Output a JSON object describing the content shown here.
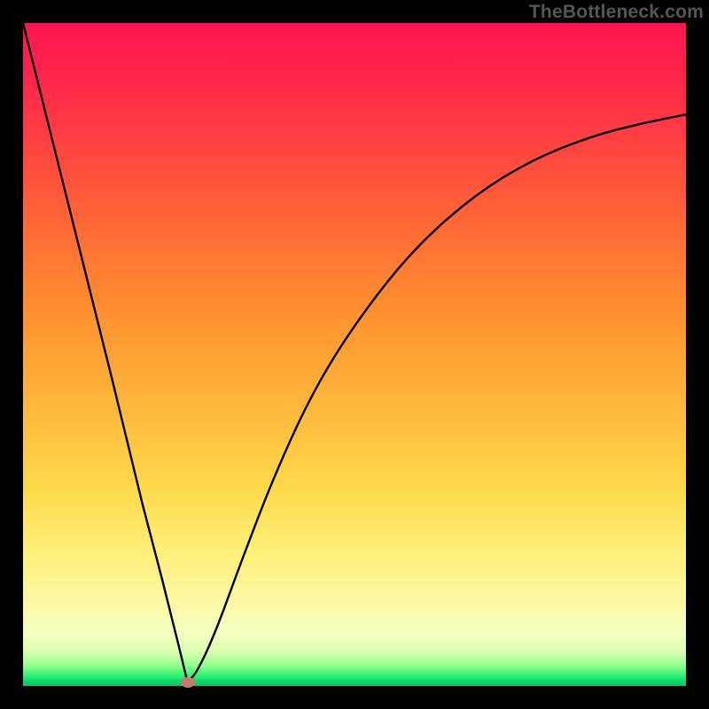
{
  "watermark": "TheBottleneck.com",
  "colors": {
    "curve_stroke": "#000000",
    "marker_fill": "#c97a6a",
    "frame_bg": "#ffffff",
    "outer_bg": "#000000"
  },
  "marker": {
    "x_frac": 0.248,
    "y_frac": 0.994
  },
  "chart_data": {
    "type": "line",
    "title": "",
    "xlabel": "",
    "ylabel": "",
    "xlim": [
      0,
      1
    ],
    "ylim": [
      0,
      1
    ],
    "note": "Axes are normalized fractions of the plot area; no numeric axis labels are visible in the image. The curve is a V-shaped dip: a steep linear descent from top-left to a minimum near x≈0.25 at the bottom, then an asymptotic rise toward ~0.85 on the right.",
    "series": [
      {
        "name": "curve",
        "x": [
          0.0,
          0.045,
          0.09,
          0.135,
          0.18,
          0.21,
          0.235,
          0.248,
          0.262,
          0.29,
          0.33,
          0.38,
          0.44,
          0.51,
          0.59,
          0.68,
          0.77,
          0.86,
          0.93,
          1.0
        ],
        "y": [
          1.0,
          0.82,
          0.64,
          0.46,
          0.275,
          0.16,
          0.06,
          0.006,
          0.02,
          0.08,
          0.19,
          0.32,
          0.45,
          0.56,
          0.66,
          0.74,
          0.795,
          0.83,
          0.848,
          0.862
        ]
      }
    ],
    "marker_point": {
      "x": 0.248,
      "y": 0.006
    }
  }
}
